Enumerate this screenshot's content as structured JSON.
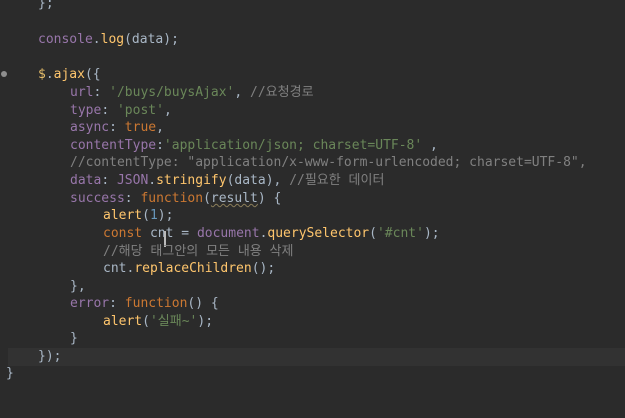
{
  "code": {
    "l1": "};",
    "l2_obj": "console",
    "l2_dot": ".",
    "l2_fn": "log",
    "l2_rest": "(data);",
    "l3_a": "$",
    "l3_b": ".",
    "l3_c": "ajax",
    "l3_d": "({",
    "l4_key": "url",
    "l4_sep": ": ",
    "l4_str": "'/buys/buysAjax'",
    "l4_comma": ", ",
    "l4_cmt": "//요청경로",
    "l5_key": "type",
    "l5_sep": ": ",
    "l5_str": "'post'",
    "l5_comma": ",",
    "l6_key": "async",
    "l6_sep": ": ",
    "l6_val": "true",
    "l6_comma": ",",
    "l7_key": "contentType",
    "l7_sep": ":",
    "l7_str": "'application/json; charset=UTF-8'",
    "l7_comma": " ,",
    "l8_cmt": "//contentType: \"application/x-www-form-urlencoded; charset=UTF-8\",",
    "l9_key": "data",
    "l9_sep": ": ",
    "l9_obj": "JSON",
    "l9_dot": ".",
    "l9_fn": "stringify",
    "l9_rest": "(data), ",
    "l9_cmt": "//필요한 데이터",
    "l10_key": "success",
    "l10_sep": ": ",
    "l10_kw": "function",
    "l10_p1": "(",
    "l10_param": "result",
    "l10_p2": ") {",
    "l11_fn": "alert",
    "l11_p1": "(",
    "l11_num": "1",
    "l11_p2": ");",
    "l12_kw": "const",
    "l12_var": " cnt ",
    "l12_eq": "= ",
    "l12_doc": "document",
    "l12_dot": ".",
    "l12_fn": "querySelector",
    "l12_p1": "(",
    "l12_str": "'#cnt'",
    "l12_p2": ");",
    "l13_cmt": "//해당 태그안의 모든 내용 삭제",
    "l14_var": "cnt",
    "l14_dot": ".",
    "l14_fn": "replaceChildren",
    "l14_rest": "();",
    "l15": "},",
    "l16_key": "error",
    "l16_sep": ": ",
    "l16_kw": "function",
    "l16_rest": "() {",
    "l17_fn": "alert",
    "l17_p1": "(",
    "l17_str": "'실패~'",
    "l17_p2": ");",
    "l18": "}",
    "l19": "});",
    "l20": "}"
  },
  "colors": {
    "background": "#2b2b2b",
    "keyword": "#cc7832",
    "string": "#6a8759",
    "function": "#ffc66d",
    "property": "#9876aa",
    "comment": "#808080"
  }
}
